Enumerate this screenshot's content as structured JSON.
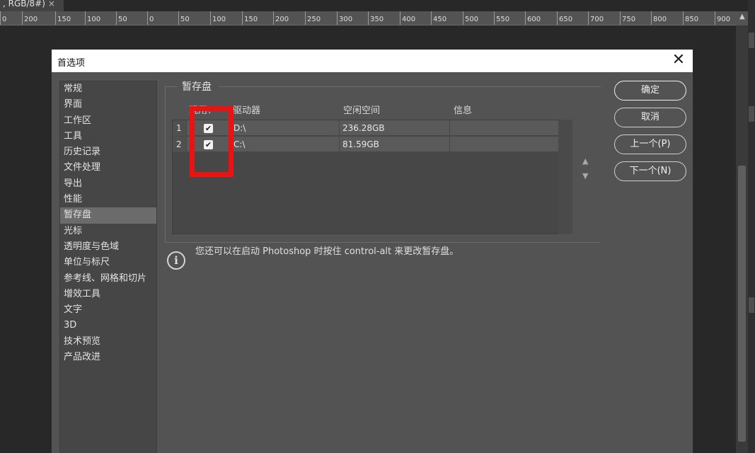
{
  "document_tab": {
    "label": ", RGB/8#)",
    "close": "×"
  },
  "ruler": {
    "ticks": [
      "0",
      "200",
      "150",
      "100",
      "50",
      "0",
      "50",
      "100",
      "150",
      "200",
      "250",
      "300",
      "350",
      "400",
      "450",
      "500",
      "550",
      "600",
      "650",
      "700",
      "750",
      "800",
      "850",
      "900"
    ],
    "scroll_up": "▲"
  },
  "dialog": {
    "title": "首选项",
    "close_glyph": "✕",
    "nav": {
      "items": [
        "常规",
        "界面",
        "工作区",
        "工具",
        "历史记录",
        "文件处理",
        "导出",
        "性能",
        "暂存盘",
        "光标",
        "透明度与色域",
        "单位与标尺",
        "参考线、网格和切片",
        "增效工具",
        "文字",
        "3D",
        "技术预览",
        "产品改进"
      ],
      "active_index": 8
    },
    "group_title": "暂存盘",
    "table": {
      "headers": {
        "active": "现用?",
        "drive": "驱动器",
        "free_space": "空闲空间",
        "info": "信息"
      },
      "rows": [
        {
          "index": "1",
          "checked": true,
          "drive": "D:\\",
          "free_space": "236.28GB",
          "info": ""
        },
        {
          "index": "2",
          "checked": true,
          "drive": "C:\\",
          "free_space": "81.59GB",
          "info": ""
        }
      ],
      "move_up": "▲",
      "move_down": "▼"
    },
    "info_icon": "i",
    "info_text": "您还可以在启动 Photoshop 时按住 control-alt 来更改暂存盘。",
    "buttons": {
      "ok": "确定",
      "cancel": "取消",
      "prev": "上一个(P)",
      "next": "下一个(N)"
    },
    "check_glyph": "✔",
    "highlight_color": "#ee1111"
  }
}
